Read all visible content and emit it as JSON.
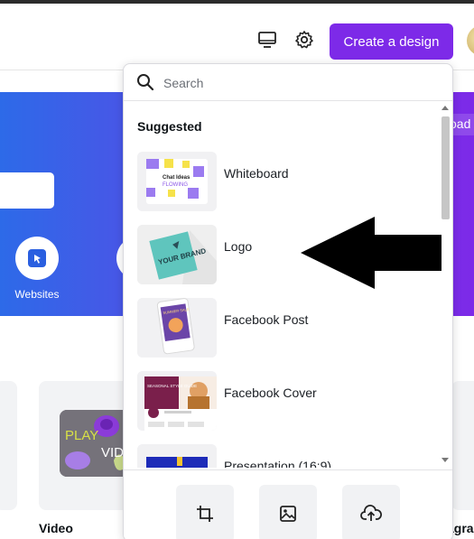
{
  "header": {
    "create_label": "Create a design",
    "icons": [
      "monitor-icon",
      "gear-icon"
    ],
    "accent_color": "#7d2ae8"
  },
  "hero": {
    "websites_label": "Websites",
    "upload_peek": "oad"
  },
  "dropdown": {
    "search_placeholder": "Search",
    "section_title": "Suggested",
    "items": [
      {
        "label": "Whiteboard"
      },
      {
        "label": "Logo"
      },
      {
        "label": "Facebook Post"
      },
      {
        "label": "Facebook Cover"
      },
      {
        "label": "Presentation (16:9)"
      }
    ],
    "actions": [
      "crop-icon",
      "image-icon",
      "upload-cloud-icon"
    ]
  },
  "thumbnails": {
    "whiteboard_text": "Chat Ideas",
    "whiteboard_sub": "FLOWING",
    "logo_text": "YOUR BRAND",
    "fbpost_text": "SUMMER SALE",
    "fbcover_text": "SEASONAL STYLE GUIDE"
  },
  "content": {
    "video_label": "Video",
    "video_thumb_text": "PLAY",
    "video_thumb_text2": "VID",
    "right_label": "agra"
  }
}
